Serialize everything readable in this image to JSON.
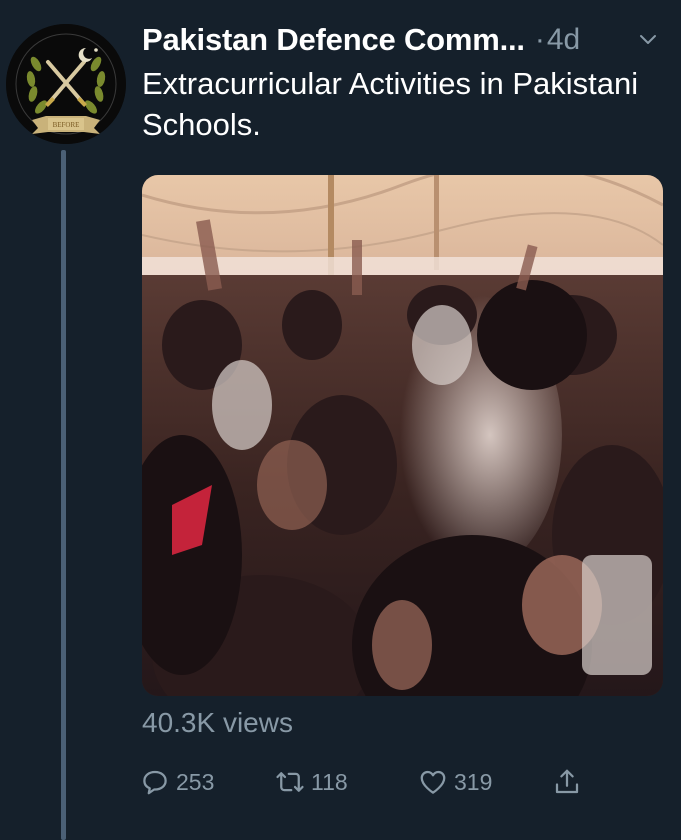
{
  "tweet": {
    "author_name": "Pakistan Defence Comm...",
    "separator": "·",
    "timestamp": "4d",
    "text": "Extracurricular Activities in Pakistani Schools.",
    "views": "40.3K views"
  },
  "actions": {
    "reply_count": "253",
    "retweet_count": "118",
    "like_count": "319"
  },
  "icons": {
    "reply": "reply-icon",
    "retweet": "retweet-icon",
    "like": "heart-icon",
    "share": "share-icon",
    "menu": "chevron-down-icon"
  },
  "colors": {
    "background": "#15202b",
    "secondary_text": "#8899a6",
    "primary_text": "#ffffff",
    "thread_line": "#4b6076"
  }
}
